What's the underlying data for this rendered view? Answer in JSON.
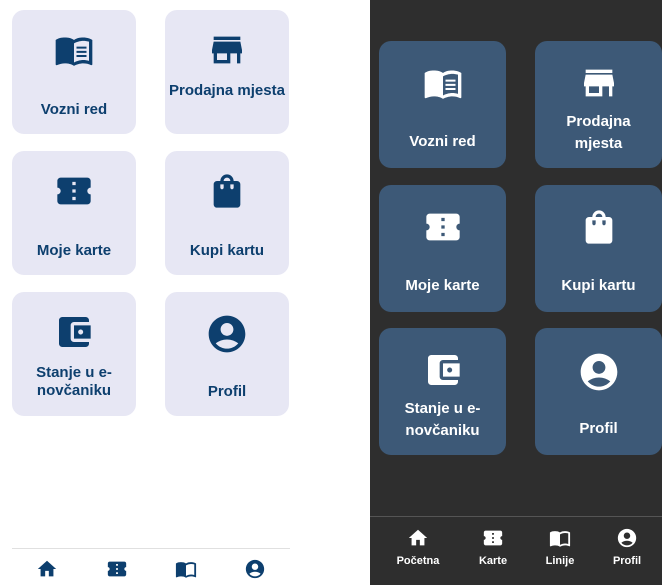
{
  "light": {
    "tiles": [
      {
        "label": "Vozni red",
        "icon": "book-icon"
      },
      {
        "label": "Prodajna mjesta",
        "icon": "store-icon"
      },
      {
        "label": "Moje karte",
        "icon": "ticket-icon"
      },
      {
        "label": "Kupi kartu",
        "icon": "shopping-bag-icon"
      },
      {
        "label": "Stanje u e-novčaniku",
        "icon": "wallet-icon"
      },
      {
        "label": "Profil",
        "icon": "account-circle-icon"
      }
    ],
    "nav": [
      {
        "icon": "home-icon"
      },
      {
        "icon": "ticket-icon"
      },
      {
        "icon": "book-icon"
      },
      {
        "icon": "account-circle-icon"
      }
    ]
  },
  "dark": {
    "tiles": [
      {
        "label": "Vozni red",
        "icon": "book-icon"
      },
      {
        "label": "Prodajna mjesta",
        "icon": "store-icon"
      },
      {
        "label": "Moje karte",
        "icon": "ticket-icon"
      },
      {
        "label": "Kupi kartu",
        "icon": "shopping-bag-icon"
      },
      {
        "label": "Stanje u e-novčaniku",
        "icon": "wallet-icon"
      },
      {
        "label": "Profil",
        "icon": "account-circle-icon"
      }
    ],
    "nav": [
      {
        "label": "Početna",
        "icon": "home-icon"
      },
      {
        "label": "Karte",
        "icon": "ticket-icon"
      },
      {
        "label": "Linije",
        "icon": "book-icon"
      },
      {
        "label": "Profil",
        "icon": "account-circle-icon"
      }
    ]
  },
  "colors": {
    "light_tile_bg": "#e7e7f4",
    "light_accent": "#0d3f6e",
    "dark_bg": "#2e2e2e",
    "dark_tile_bg": "#3d5977",
    "dark_text": "#ffffff"
  }
}
